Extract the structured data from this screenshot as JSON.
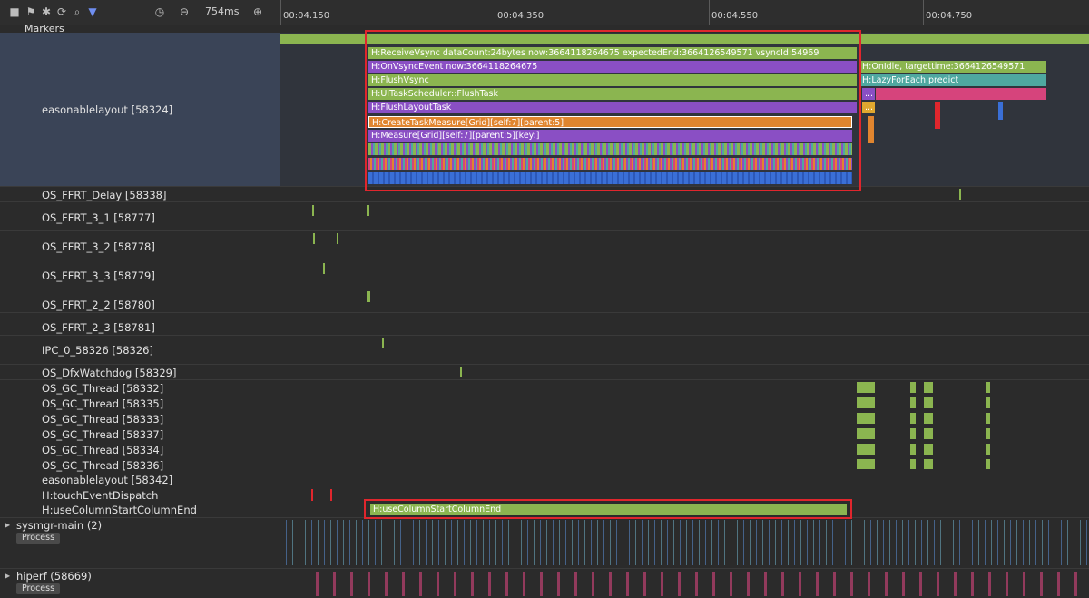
{
  "toolbar": {
    "icons": [
      "square-icon",
      "flag-icon",
      "circle-gear-icon",
      "refresh-icon",
      "search-icon",
      "filter-icon",
      "clock-icon",
      "zoom-out-icon",
      "zoom-in-icon"
    ],
    "zoom_value": "754ms"
  },
  "timeline": {
    "ticks": [
      "00:04.150",
      "00:04.350",
      "00:04.550",
      "00:04.750"
    ]
  },
  "rows": {
    "markers": "Markers",
    "main_thread": "easonablelayout [58324]",
    "threads": [
      "OS_FFRT_Delay [58338]",
      "OS_FFRT_3_1 [58777]",
      "OS_FFRT_3_2 [58778]",
      "OS_FFRT_3_3 [58779]",
      "OS_FFRT_2_2 [58780]",
      "OS_FFRT_2_3 [58781]",
      "IPC_0_58326 [58326]",
      "OS_DfxWatchdog [58329]",
      "OS_GC_Thread [58332]",
      "OS_GC_Thread [58335]",
      "OS_GC_Thread [58333]",
      "OS_GC_Thread [58337]",
      "OS_GC_Thread [58334]",
      "OS_GC_Thread [58336]",
      "easonablelayout [58342]",
      "H:touchEventDispatch",
      "H:useColumnStartColumnEnd"
    ],
    "processes": [
      {
        "name": "sysmgr-main (2)",
        "badge": "Process"
      },
      {
        "name": "hiperf (58669)",
        "badge": "Process"
      }
    ]
  },
  "slices": {
    "receive_vsync": "H:ReceiveVsync dataCount:24bytes now:3664118264675 expectedEnd:3664126549571 vsyncId:54969",
    "on_vsync_event": "H:OnVsyncEvent now:3664118264675",
    "on_idle": "H:OnIdle, targettime:3664126549571",
    "flush_vsync": "H:FlushVsync",
    "lazy_for_each": "H:LazyForEach predict",
    "ui_task_scheduler": "H:UITaskScheduler::FlushTask",
    "ellipsis_a": "...",
    "flush_layout": "H:FlushLayoutTask",
    "ellipsis_b": "...",
    "create_task_measure": "H:CreateTaskMeasure[Grid][self:7][parent:5]",
    "measure_grid": "H:Measure[Grid][self:7][parent:5][key:]",
    "use_column": "H:useColumnStartColumnEnd"
  },
  "colors": {
    "green": "#8bb550",
    "purple": "#8a4fc4",
    "teal": "#4fa8a0",
    "orange": "#e0852f",
    "pink": "#d6447c",
    "blue": "#3a6fd6",
    "highlight": "#e0262d"
  }
}
